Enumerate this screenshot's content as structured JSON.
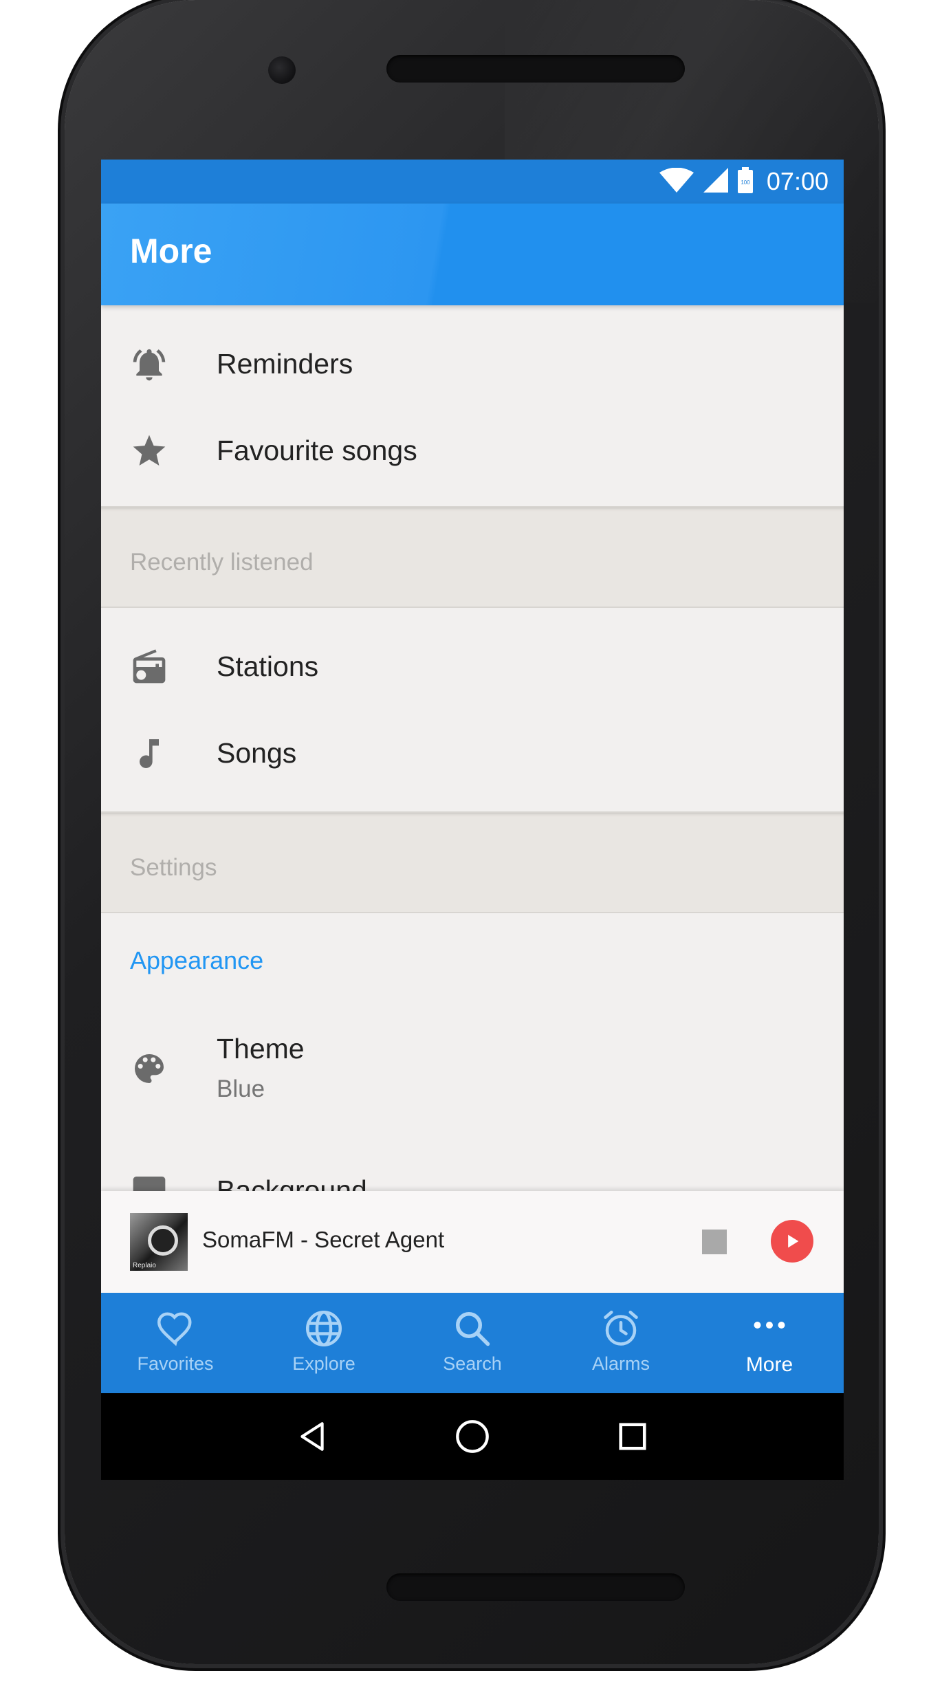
{
  "status_bar": {
    "time": "07:00",
    "battery_text": "100"
  },
  "app_bar": {
    "title": "More"
  },
  "menu_top": [
    {
      "label": "Reminders",
      "icon": "bell-icon"
    },
    {
      "label": "Favourite songs",
      "icon": "star-icon"
    }
  ],
  "sections": {
    "recently_listened": "Recently listened",
    "settings": "Settings"
  },
  "recent_items": [
    {
      "label": "Stations",
      "icon": "radio-icon"
    },
    {
      "label": "Songs",
      "icon": "music-note-icon"
    }
  ],
  "settings": {
    "group_title": "Appearance",
    "theme": {
      "label": "Theme",
      "value": "Blue",
      "icon": "palette-icon"
    },
    "background": {
      "label": "Background"
    }
  },
  "player": {
    "title": "SomaFM - Secret Agent",
    "album_art_text": "Replaio"
  },
  "bottom_nav": [
    {
      "label": "Favorites",
      "icon": "heart-icon",
      "active": false
    },
    {
      "label": "Explore",
      "icon": "globe-icon",
      "active": false
    },
    {
      "label": "Search",
      "icon": "search-icon",
      "active": false
    },
    {
      "label": "Alarms",
      "icon": "alarm-clock-icon",
      "active": false
    },
    {
      "label": "More",
      "icon": "more-dots-icon",
      "active": true
    }
  ],
  "colors": {
    "primary": "#2196f3",
    "primary_dark": "#1e7fd8",
    "accent": "#f04c4c",
    "background": "#f2f0ef"
  }
}
